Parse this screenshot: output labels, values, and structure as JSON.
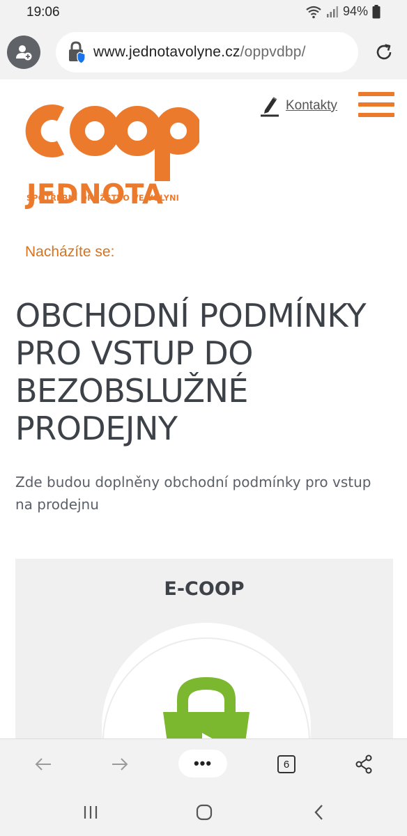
{
  "status_bar": {
    "time": "19:06",
    "battery": "94%"
  },
  "browser": {
    "url_domain": "www.jednotavolyne.cz",
    "url_path": "/oppvdbp/",
    "tab_count": "6",
    "menu_label": "•••"
  },
  "site": {
    "logo_main": "coop",
    "logo_name": "JEDNOTA",
    "logo_subtitle": "SPOTŘEBNÍ DRUŽSTVO VE VOLYNI",
    "contacts_label": "Kontakty",
    "breadcrumb": "Nacházíte se:",
    "title": "OBCHODNÍ PODMÍNKY PRO VSTUP DO BEZOBSLUŽNÉ PRODEJNY",
    "description": "Zde budou doplněny obchodní podmínky pro vstup na prodejnu",
    "ecoop_title": "E-COOP"
  },
  "colors": {
    "brand_orange": "#ec7a2c",
    "breadcrumb_orange": "#d6731f",
    "bag_green": "#7cb82f",
    "card_bg": "#f0f0f0"
  },
  "icons": {
    "status": [
      "wifi-icon",
      "signal-icon",
      "battery-icon"
    ],
    "browser": [
      "profile-icon",
      "lock-shield-icon",
      "reload-icon"
    ],
    "toolbar": [
      "back-arrow-icon",
      "forward-arrow-icon",
      "more-icon",
      "tabs-icon",
      "share-icon"
    ],
    "nav": [
      "recents-icon",
      "home-icon",
      "back-icon"
    ],
    "site": [
      "pen-icon",
      "hamburger-menu-icon",
      "shopping-bag-icon"
    ]
  }
}
